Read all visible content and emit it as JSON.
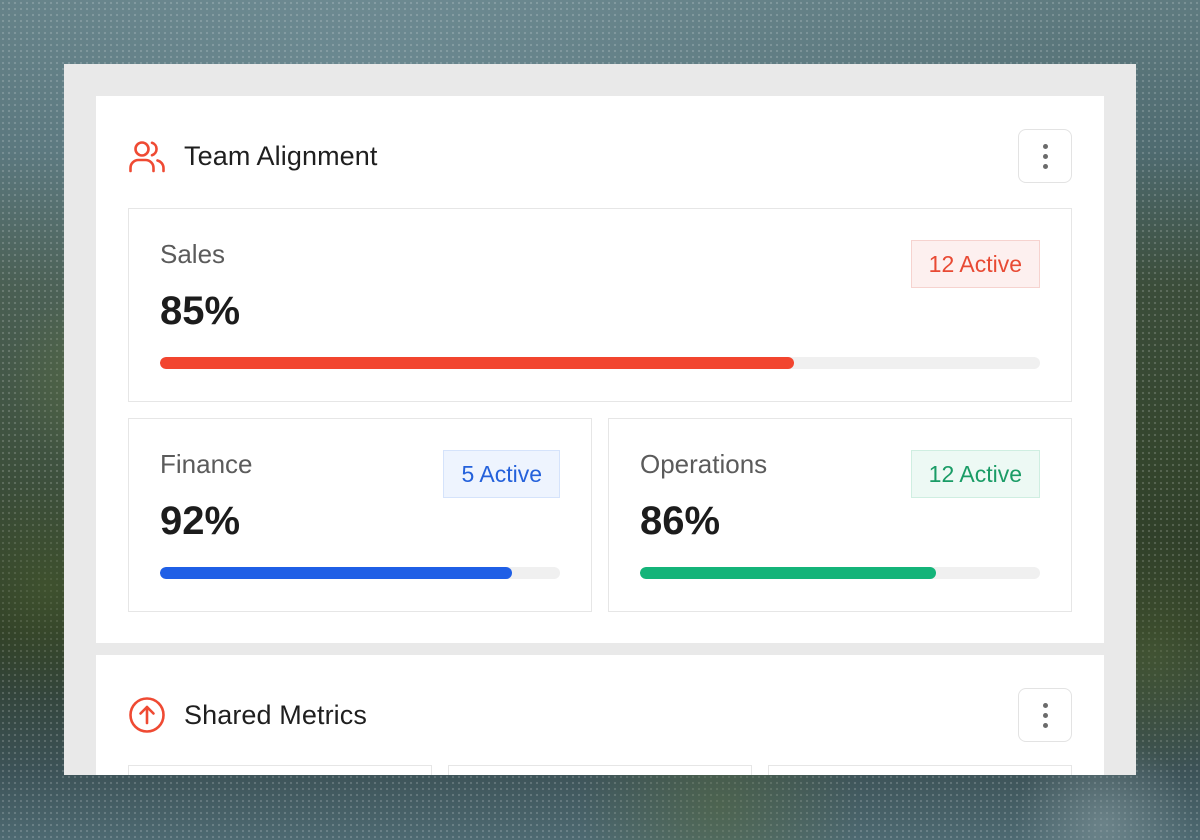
{
  "team_alignment": {
    "title": "Team Alignment",
    "icon": "users-icon",
    "menu_icon": "more-vertical-icon",
    "tiles": [
      {
        "label": "Sales",
        "value": "85%",
        "badge": "12 Active",
        "progress": 0.72,
        "color": "#f2452f"
      },
      {
        "label": "Finance",
        "value": "92%",
        "badge": "5 Active",
        "progress": 0.88,
        "color": "#1f5fe6"
      },
      {
        "label": "Operations",
        "value": "86%",
        "badge": "12 Active",
        "progress": 0.74,
        "color": "#14b479"
      }
    ]
  },
  "shared_metrics": {
    "title": "Shared Metrics",
    "icon": "arrow-up-circle-icon",
    "menu_icon": "more-vertical-icon"
  }
}
